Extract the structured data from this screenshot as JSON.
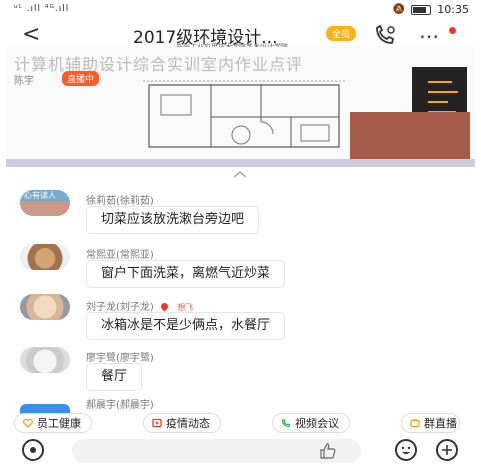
{
  "status_bar": {
    "signal_text": "ᵘᴸ .ıll ⁴ᴳ.ıll",
    "time": "10:35"
  },
  "header": {
    "back_glyph": "<",
    "title": "2017级环境设计...",
    "badge": "全员",
    "subtitle": "郑州工业应用技术学院艺术设计学院"
  },
  "live_video": {
    "title": "计算机辅助设计综合实训室内作业点评",
    "presenter": "陈宇",
    "live_tag": "直播中"
  },
  "messages": [
    {
      "sender": "徐莉茹(徐莉茹)",
      "text": "切菜应该放洗漱台旁边吧",
      "avatar_label": "心有读人"
    },
    {
      "sender": "常熙亚(常熙亚)",
      "text": "窗户下面洗菜，离燃气近炒菜"
    },
    {
      "sender": "刘子龙(刘子龙)",
      "text": "冰箱冰是不是少俩点，水餐厅",
      "extra_tag": "想飞"
    },
    {
      "sender": "廖宇鹭(廖宇鹭)",
      "text": "餐厅"
    },
    {
      "sender": "郝晨宇(郝晨宇)",
      "text": ""
    }
  ],
  "shortcuts": [
    {
      "label": "员工健康",
      "icon": "heart-icon",
      "color": "#f0a020"
    },
    {
      "label": "疫情动态",
      "icon": "shield-icon",
      "color": "#e53935"
    },
    {
      "label": "视频会议",
      "icon": "video-call-icon",
      "color": "#2e9e5b"
    },
    {
      "label": "群直播",
      "icon": "live-tv-icon",
      "color": "#f0a020"
    }
  ],
  "colors": {
    "accent_orange": "#ffb21a",
    "live_red": "#ff5a2a"
  }
}
